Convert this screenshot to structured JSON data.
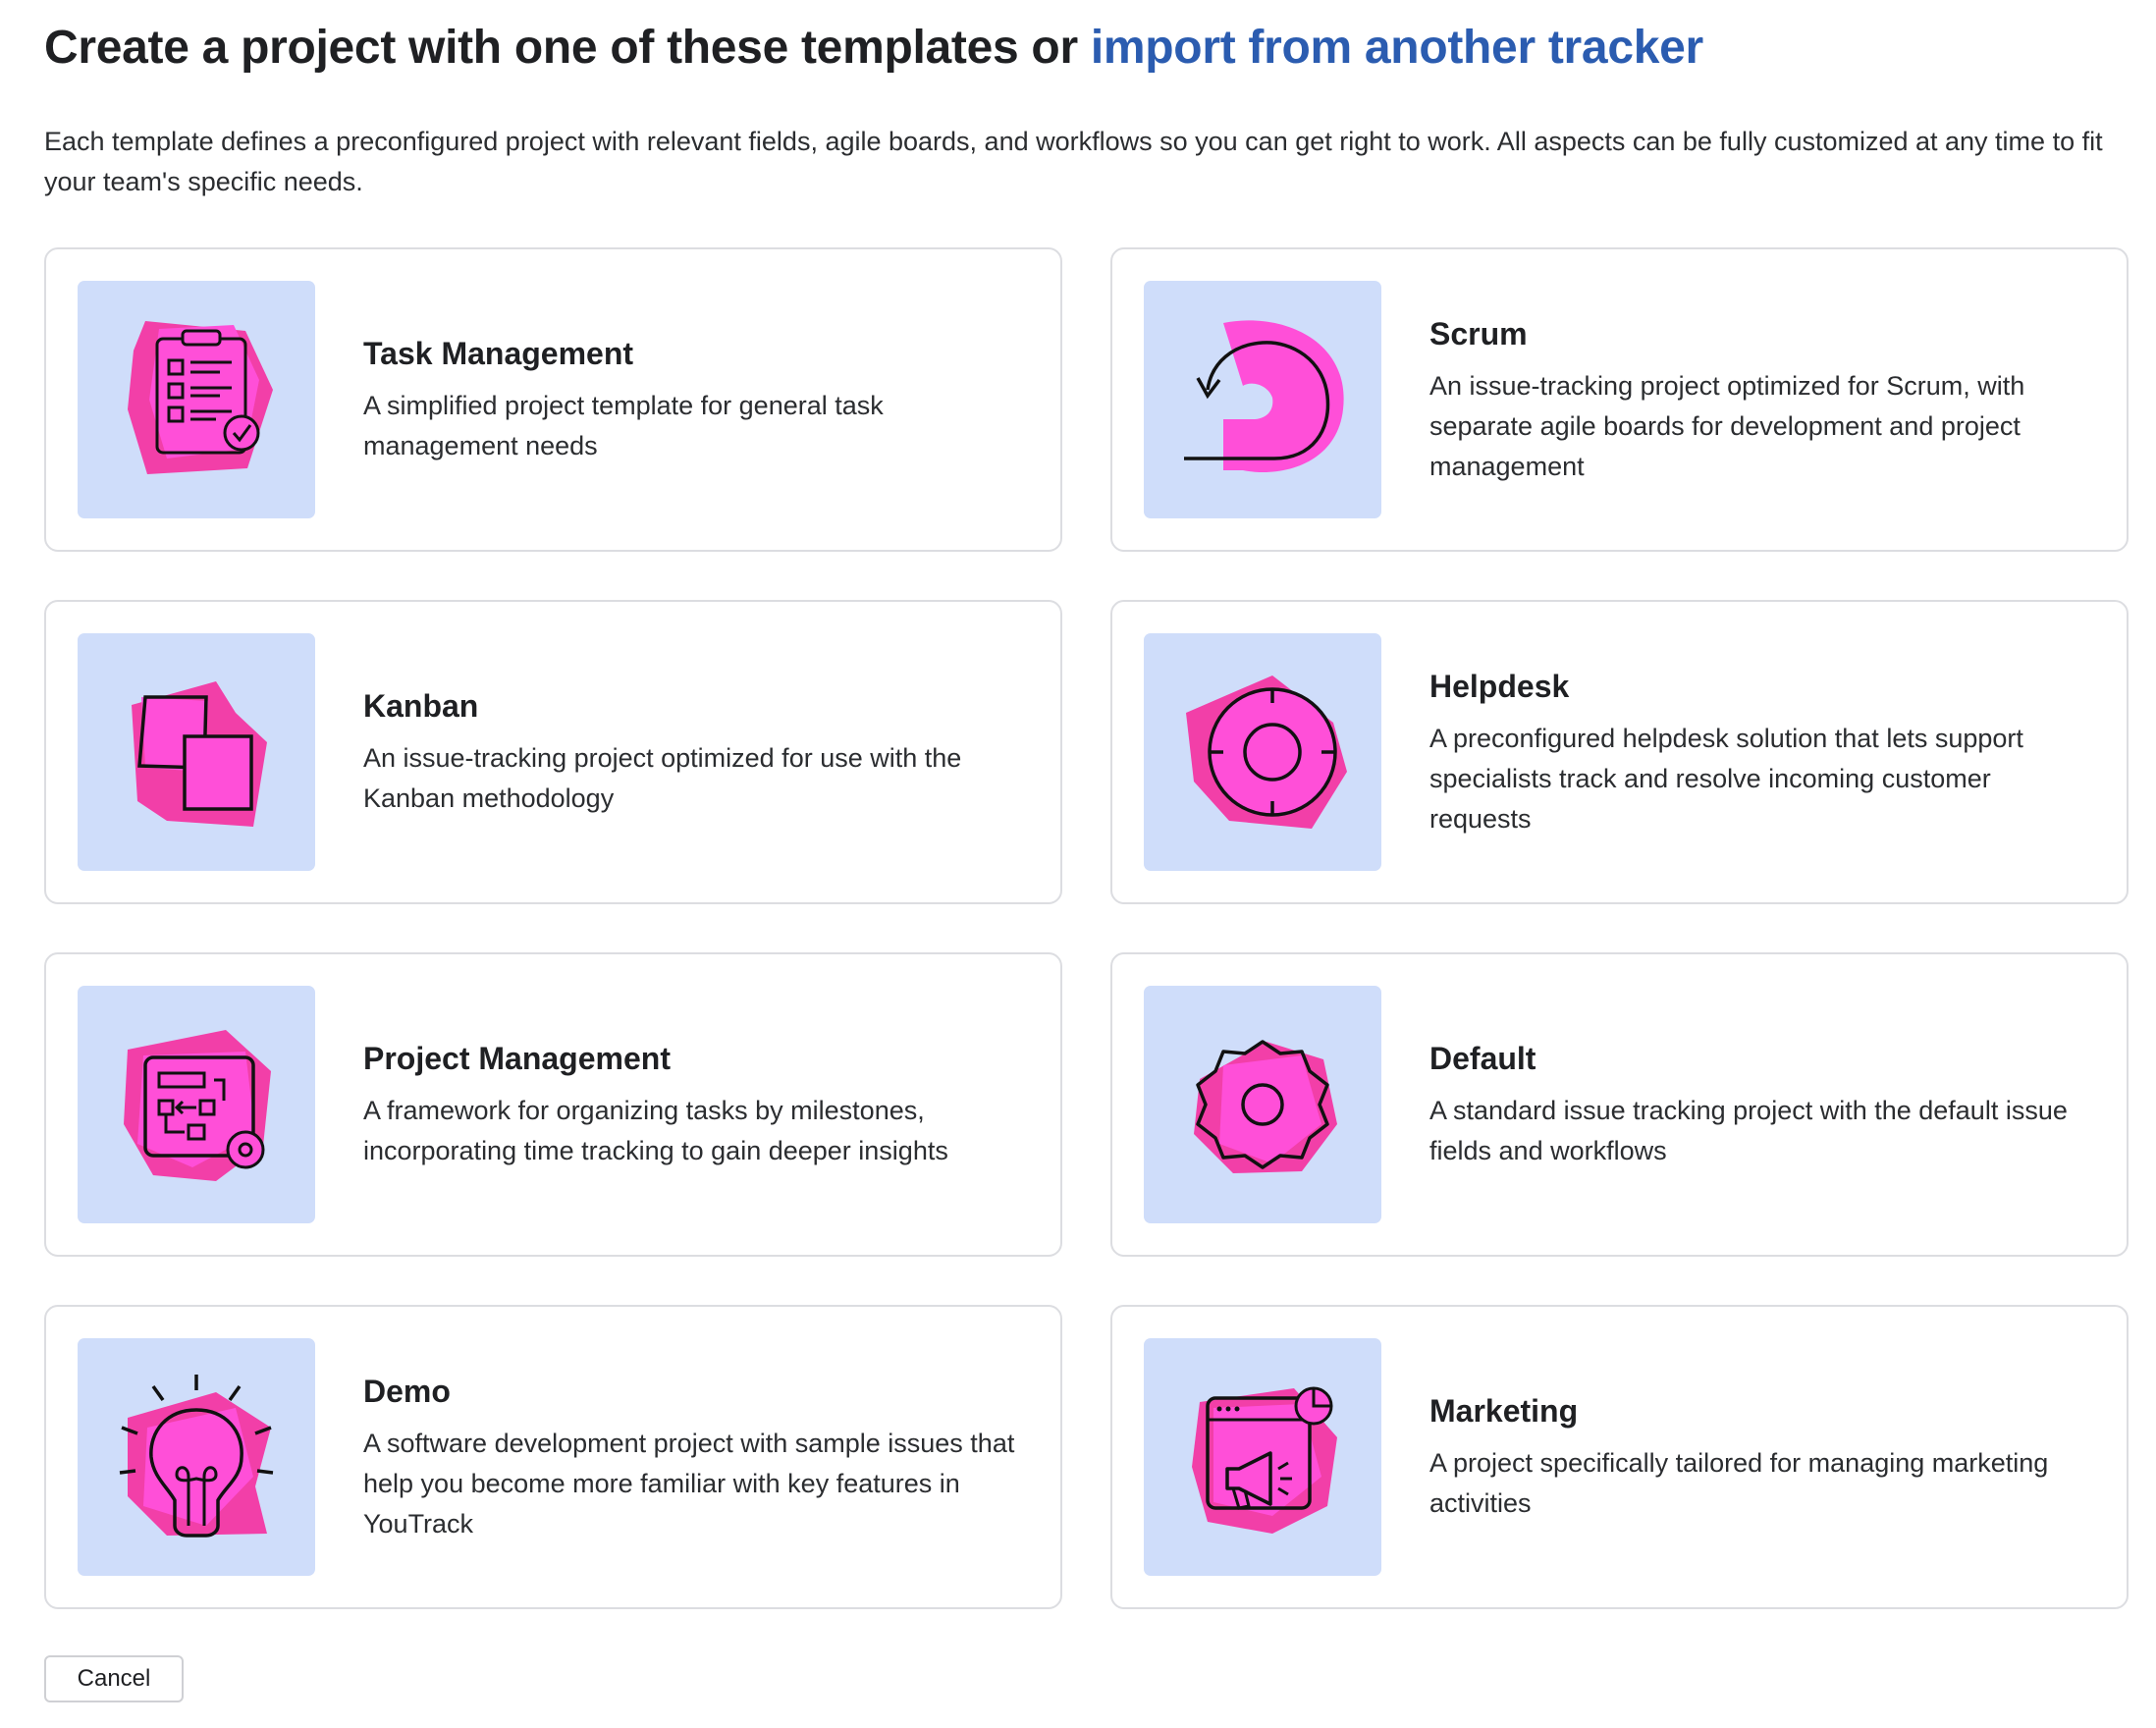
{
  "header": {
    "title_prefix": "Create a project with one of these templates or ",
    "title_link": "import from another tracker",
    "description": "Each template defines a preconfigured project with relevant fields, agile boards, and workflows so you can get right to work. All aspects can be fully customized at any time to fit your team's specific needs."
  },
  "templates": [
    {
      "title": "Task Management",
      "description": "A simplified project template for general task management needs",
      "icon": "clipboard-checklist-icon"
    },
    {
      "title": "Scrum",
      "description": "An issue-tracking project optimized for Scrum, with separate agile boards for development and project management",
      "icon": "scrum-loop-icon"
    },
    {
      "title": "Kanban",
      "description": "An issue-tracking project optimized for use with the Kanban methodology",
      "icon": "kanban-cards-icon"
    },
    {
      "title": "Helpdesk",
      "description": "A preconfigured helpdesk solution that lets support specialists track and resolve incoming customer requests",
      "icon": "lifebuoy-icon"
    },
    {
      "title": "Project Management",
      "description": "A framework for organizing tasks by milestones, incorporating time tracking to gain deeper insights",
      "icon": "flowchart-gear-icon"
    },
    {
      "title": "Default",
      "description": "A standard issue tracking project with the default issue fields and workflows",
      "icon": "gear-icon"
    },
    {
      "title": "Demo",
      "description": "A software development project with sample issues that help you become more familiar with key features in YouTrack",
      "icon": "lightbulb-icon"
    },
    {
      "title": "Marketing",
      "description": "A project specifically tailored for managing marketing activities",
      "icon": "megaphone-browser-icon"
    }
  ],
  "footer": {
    "cancel_label": "Cancel"
  },
  "colors": {
    "link": "#2b5cb0",
    "thumb_bg": "#cfddfa",
    "blob_pink": "#ff4fd8",
    "blob_magenta": "#f23fa8"
  }
}
